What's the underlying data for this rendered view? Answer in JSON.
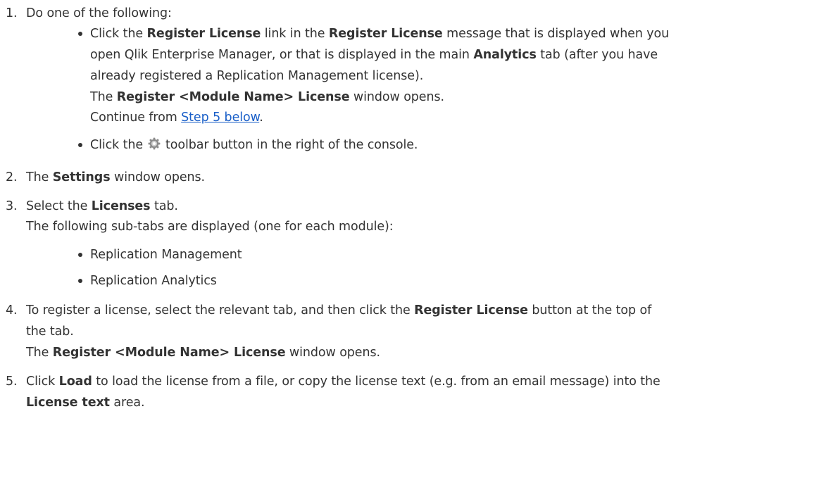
{
  "steps": [
    {
      "number": "1.",
      "text": "Do one of the following:",
      "options": [
        {
          "line1": [
            "Click the ",
            "Register License",
            " link in the ",
            "Register License",
            " message that is displayed when you"
          ],
          "line2": "open Qlik Enterprise Manager, or that is displayed in the main ",
          "line2_bold": "Analytics",
          "line2_end": " tab (after you have",
          "line3": "already registered a Replication Management license).",
          "line4": [
            "The ",
            "Register <Module Name> License",
            " window opens."
          ],
          "line5_prefix": "Continue from ",
          "line5_link": "Step 5 below",
          "line5_suffix": "."
        },
        {
          "prefix": "Click the ",
          "icon": "gear-icon",
          "suffix": " toolbar button in the right of the console."
        }
      ]
    },
    {
      "number": "2.",
      "parts": [
        "The ",
        "Settings",
        " window opens."
      ]
    },
    {
      "number": "3.",
      "parts": [
        "Select the ",
        "Licenses",
        " tab."
      ],
      "line2": "The following sub-tabs are displayed (one for each module):",
      "subtabs": [
        "Replication Management",
        "Replication Analytics"
      ]
    },
    {
      "number": "4.",
      "parts": [
        "To register a license, select the relevant tab, and then click the ",
        "Register License",
        " button at the top of"
      ],
      "line2": "the tab.",
      "line3": [
        "The ",
        "Register <Module Name> License",
        " window opens."
      ]
    },
    {
      "number": "5.",
      "parts": [
        "Click ",
        "Load",
        " to load the license from a file, or copy the license text (e.g. from an email message) into the"
      ],
      "line2": [
        "License text",
        " area."
      ]
    }
  ]
}
